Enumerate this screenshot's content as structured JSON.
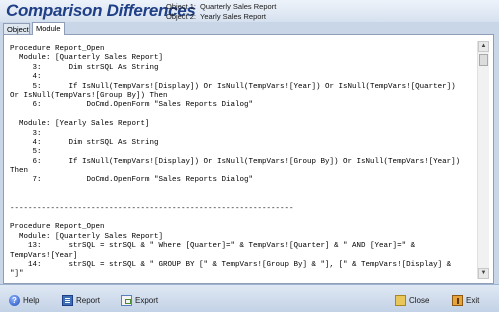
{
  "window": {
    "title": "Comparison Differences"
  },
  "objects": [
    {
      "label": "Object 1:",
      "value": "Quarterly Sales Report"
    },
    {
      "label": "Object 2:",
      "value": "Yearly Sales Report"
    }
  ],
  "tabs": [
    {
      "label": "Object",
      "active": false
    },
    {
      "label": "Module",
      "active": true
    }
  ],
  "code_lines": [
    "Procedure Report_Open",
    "  Module: [Quarterly Sales Report]",
    "     3:      Dim strSQL As String",
    "     4:",
    "     5:      If IsNull(TempVars![Display]) Or IsNull(TempVars![Year]) Or IsNull(TempVars![Quarter])",
    "Or IsNull(TempVars![Group By]) Then",
    "     6:          DoCmd.OpenForm \"Sales Reports Dialog\"",
    "",
    "  Module: [Yearly Sales Report]",
    "     3:",
    "     4:      Dim strSQL As String",
    "     5:",
    "     6:      If IsNull(TempVars![Display]) Or IsNull(TempVars![Group By]) Or IsNull(TempVars![Year])",
    "Then",
    "     7:          DoCmd.OpenForm \"Sales Reports Dialog\"",
    "",
    "",
    "---------------------------------------------------------------",
    "",
    "Procedure Report_Open",
    "  Module: [Quarterly Sales Report]",
    "    13:      strSQL = strSQL & \" Where [Quarter]=\" & TempVars![Quarter] & \" AND [Year]=\" &",
    "TempVars![Year]",
    "    14:      strSQL = strSQL & \" GROUP BY [\" & TempVars![Group By] & \"], [\" & TempVars![Display] &",
    "\"]\""
  ],
  "footer": {
    "help": "Help",
    "report": "Report",
    "export": "Export",
    "close": "Close",
    "exit": "Exit"
  },
  "icons": {
    "help": "help-icon",
    "report": "report-icon",
    "export": "export-icon",
    "close": "folder-close-icon",
    "exit": "exit-door-icon"
  }
}
